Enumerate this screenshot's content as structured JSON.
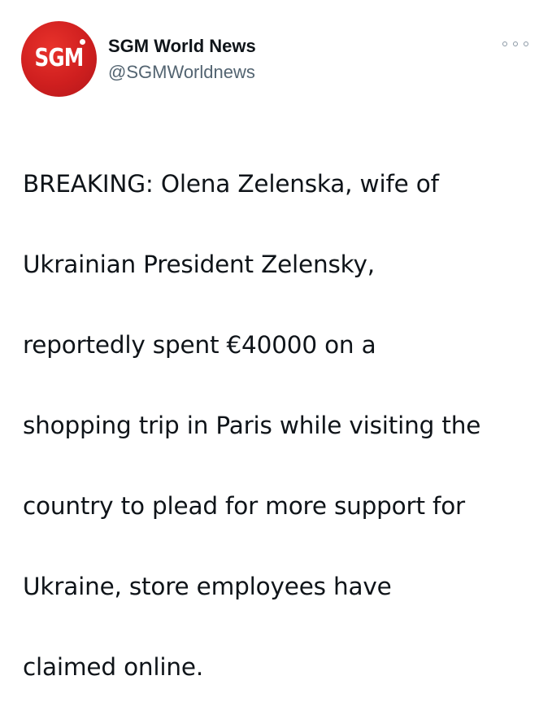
{
  "author": {
    "avatar_text": "SGM",
    "avatar_color": "#cf1f1f",
    "display_name": "SGM World News",
    "handle": "@SGMWorldnews"
  },
  "more_icon": "more-horizontal-icon",
  "tweet": {
    "lines": [
      "BREAKING: Olena Zelenska, wife of",
      "Ukrainian President Zelensky,",
      "reportedly spent €40000 on a",
      "shopping trip in Paris while visiting the",
      "country to plead for more support for",
      "Ukraine, store employees have",
      "claimed online."
    ]
  }
}
